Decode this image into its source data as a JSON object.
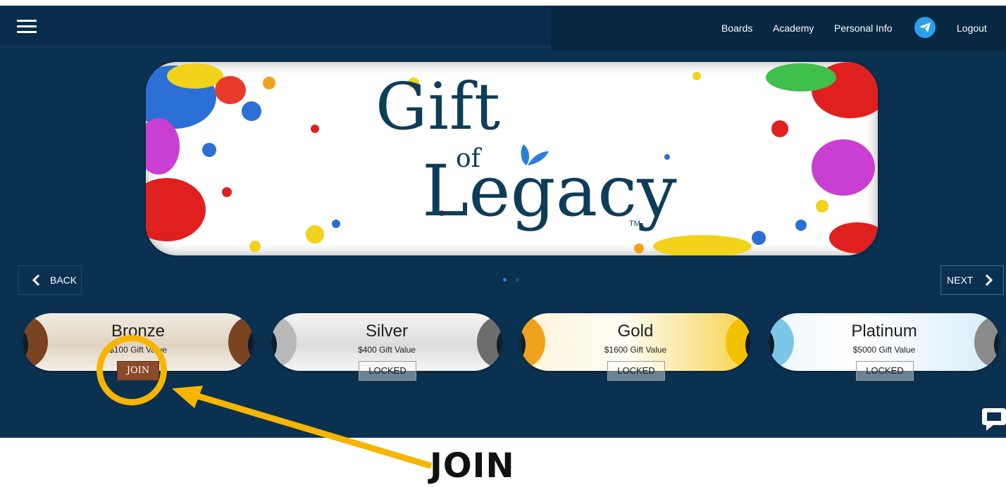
{
  "topbar": {
    "nav": [
      {
        "label": "Boards"
      },
      {
        "label": "Academy"
      },
      {
        "label": "Personal Info"
      },
      {
        "label": "Logout"
      }
    ],
    "icons": [
      "hamburger-menu-icon",
      "telegram-icon"
    ]
  },
  "banner": {
    "logo_line1": "Gift",
    "logo_line2": "of",
    "logo_line3": "Legacy",
    "logo_tm": "TM"
  },
  "carousel": {
    "back_label": "BACK",
    "next_label": "NEXT",
    "dots_total": 2,
    "dots_active": 1
  },
  "tiers": [
    {
      "name": "Bronze",
      "value": "$100 Gift Value",
      "status": "JOIN"
    },
    {
      "name": "Silver",
      "value": "$400 Gift Value",
      "status": "LOCKED"
    },
    {
      "name": "Gold",
      "value": "$1600 Gift Value",
      "status": "LOCKED"
    },
    {
      "name": "Platinum",
      "value": "$5000 Gift Value",
      "status": "LOCKED"
    }
  ],
  "annotation": {
    "label": "JOIN",
    "color": "#f7b500"
  },
  "colors": {
    "app_background": "#0b3150",
    "telegram": "#2aa0e8",
    "join_button": "#8b4a2a"
  }
}
